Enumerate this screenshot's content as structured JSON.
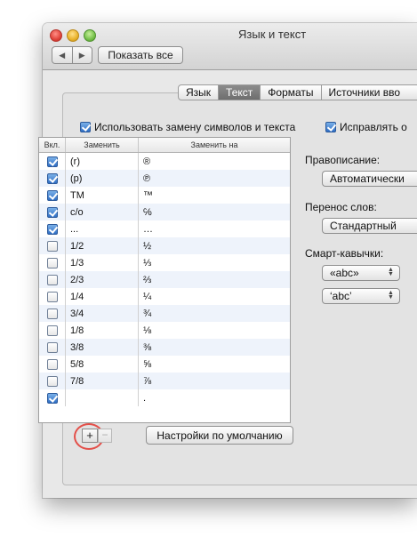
{
  "window": {
    "title": "Язык и текст"
  },
  "toolbar": {
    "back_glyph": "◀",
    "forward_glyph": "▶",
    "show_all_label": "Показать все"
  },
  "tabs": [
    {
      "label": "Язык",
      "active": false
    },
    {
      "label": "Текст",
      "active": true
    },
    {
      "label": "Форматы",
      "active": false
    },
    {
      "label": "Источники вво",
      "active": false
    }
  ],
  "substitution": {
    "checked": true,
    "label": "Использовать замену символов и текста"
  },
  "table": {
    "headers": [
      "Вкл.",
      "Заменить",
      "Заменить на"
    ],
    "rows": [
      {
        "on": true,
        "replace": "(r)",
        "with": "®"
      },
      {
        "on": true,
        "replace": "(p)",
        "with": "℗"
      },
      {
        "on": true,
        "replace": "TM",
        "with": "™"
      },
      {
        "on": true,
        "replace": "c/o",
        "with": "℅"
      },
      {
        "on": true,
        "replace": "...",
        "with": "…"
      },
      {
        "on": false,
        "replace": "1/2",
        "with": "½"
      },
      {
        "on": false,
        "replace": "1/3",
        "with": "⅓"
      },
      {
        "on": false,
        "replace": "2/3",
        "with": "⅔"
      },
      {
        "on": false,
        "replace": "1/4",
        "with": "¼"
      },
      {
        "on": false,
        "replace": "3/4",
        "with": "¾"
      },
      {
        "on": false,
        "replace": "1/8",
        "with": "⅛"
      },
      {
        "on": false,
        "replace": "3/8",
        "with": "⅜"
      },
      {
        "on": false,
        "replace": "5/8",
        "with": "⅝"
      },
      {
        "on": false,
        "replace": "7/8",
        "with": "⅞"
      },
      {
        "on": true,
        "replace": "",
        "with": "."
      }
    ]
  },
  "buttons": {
    "add": "+",
    "remove": "−",
    "defaults": "Настройки по умолчанию"
  },
  "right": {
    "correct_checkbox": {
      "checked": true,
      "label": "Исправлять о"
    },
    "spelling_label": "Правописание:",
    "spelling_value": "Автоматически",
    "hyphen_label": "Перенос слов:",
    "hyphen_value": "Стандартный",
    "quotes_label": "Смарт-кавычки:",
    "double_quotes_value": "«abc»",
    "single_quotes_value": "‘abc’",
    "popup_arrows": "▲▼"
  }
}
